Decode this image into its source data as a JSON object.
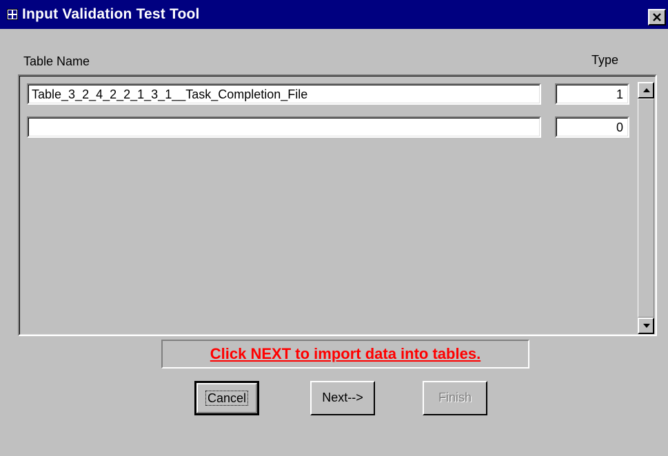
{
  "window": {
    "title": "Input Validation Test Tool",
    "close_glyph": "✕"
  },
  "labels": {
    "table_name": "Table Name",
    "type": "Type"
  },
  "rows": [
    {
      "table_name": "Table_3_2_4_2_2_1_3_1__Task_Completion_File",
      "type": "1"
    },
    {
      "table_name": "",
      "type": "0"
    }
  ],
  "message": "Click NEXT to import data into tables.",
  "buttons": {
    "cancel": "Cancel",
    "next": "Next-->",
    "finish": "Finish"
  },
  "icons": {
    "title": "form-icon",
    "close": "close-icon",
    "scroll_up": "arrow-up-icon",
    "scroll_down": "arrow-down-icon"
  },
  "colors": {
    "titlebar": "#000080",
    "face": "#c0c0c0",
    "message": "#ff0000"
  }
}
